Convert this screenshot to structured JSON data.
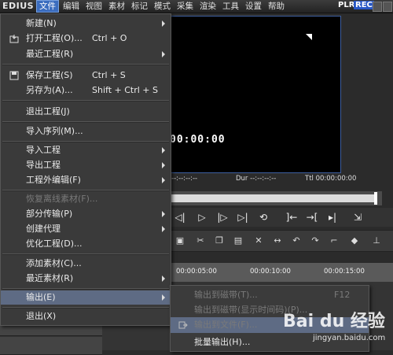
{
  "app": {
    "logo": "EDIUS"
  },
  "menubar": {
    "items": [
      "文件",
      "编辑",
      "视图",
      "素材",
      "标记",
      "模式",
      "采集",
      "渲染",
      "工具",
      "设置",
      "帮助"
    ],
    "plr": "PLR",
    "rec": "REC"
  },
  "preview": {
    "timecode": "00:00:00",
    "info": {
      "dur": "Dur --:--:--:--",
      "ttl": "Ttl 00:00:00:00",
      "left": "--:--:--:--"
    }
  },
  "ruler": {
    "ticks": [
      "00:00:05:00",
      "00:00:10:00",
      "00:00:15:00"
    ]
  },
  "file_menu": {
    "items": [
      {
        "label": "新建(N)",
        "shortcut": "",
        "submenu": true,
        "disabled": false
      },
      {
        "label": "打开工程(O)...",
        "shortcut": "Ctrl + O",
        "submenu": false,
        "disabled": false,
        "icon": "open-folder-icon"
      },
      {
        "label": "最近工程(R)",
        "shortcut": "",
        "submenu": true,
        "disabled": false
      },
      {
        "label": "保存工程(S)",
        "shortcut": "Ctrl + S",
        "submenu": false,
        "disabled": false,
        "icon": "save-disk-icon"
      },
      {
        "label": "另存为(A)...",
        "shortcut": "Shift + Ctrl + S",
        "submenu": false,
        "disabled": false
      },
      {
        "label": "退出工程(J)",
        "shortcut": "",
        "submenu": false,
        "disabled": false
      },
      {
        "label": "导入序列(M)...",
        "shortcut": "",
        "submenu": false,
        "disabled": false
      },
      {
        "label": "导入工程",
        "shortcut": "",
        "submenu": true,
        "disabled": false
      },
      {
        "label": "导出工程",
        "shortcut": "",
        "submenu": true,
        "disabled": false
      },
      {
        "label": "工程外编辑(F)",
        "shortcut": "",
        "submenu": true,
        "disabled": false
      },
      {
        "label": "恢复离线素材(F)...",
        "shortcut": "",
        "submenu": false,
        "disabled": true
      },
      {
        "label": "部分传输(P)",
        "shortcut": "",
        "submenu": true,
        "disabled": false
      },
      {
        "label": "创建代理",
        "shortcut": "",
        "submenu": true,
        "disabled": false
      },
      {
        "label": "优化工程(D)...",
        "shortcut": "",
        "submenu": false,
        "disabled": false
      },
      {
        "label": "添加素材(C)...",
        "shortcut": "",
        "submenu": false,
        "disabled": false
      },
      {
        "label": "最近素材(R)",
        "shortcut": "",
        "submenu": true,
        "disabled": false
      },
      {
        "label": "输出(E)",
        "shortcut": "",
        "submenu": true,
        "disabled": false,
        "highlighted": true
      },
      {
        "label": "退出(X)",
        "shortcut": "",
        "submenu": false,
        "disabled": false
      }
    ]
  },
  "output_submenu": {
    "items": [
      {
        "label": "输出到磁带(T)...",
        "shortcut": "F12",
        "disabled": true
      },
      {
        "label": "输出到磁带(显示时间码)(P)...",
        "shortcut": "",
        "disabled": true
      },
      {
        "label": "输出到文件(F)...",
        "shortcut": "",
        "disabled": true,
        "highlighted": true,
        "icon": "export-file-icon"
      },
      {
        "label": "批量输出(H)...",
        "shortcut": "",
        "disabled": false
      }
    ]
  },
  "watermark": {
    "brand": "Bai du 经验",
    "url": "jingyan.baidu.com"
  }
}
